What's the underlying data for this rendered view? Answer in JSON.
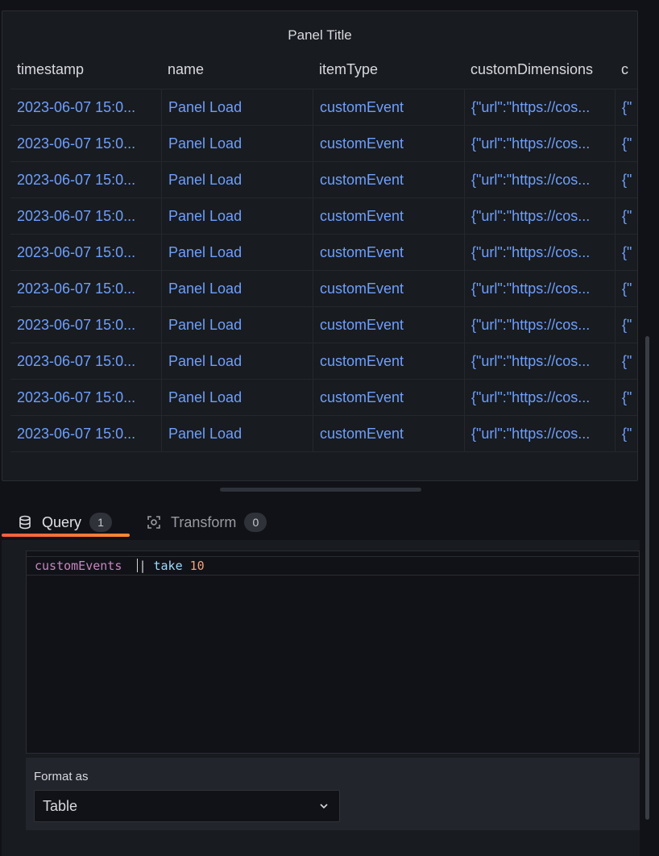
{
  "panel": {
    "title": "Panel Title",
    "columns": [
      "timestamp",
      "name",
      "itemType",
      "customDimensions",
      "c"
    ],
    "rows": [
      [
        "2023-06-07 15:0...",
        "Panel Load",
        "customEvent",
        "{\"url\":\"https://cos...",
        "{\""
      ],
      [
        "2023-06-07 15:0...",
        "Panel Load",
        "customEvent",
        "{\"url\":\"https://cos...",
        "{\""
      ],
      [
        "2023-06-07 15:0...",
        "Panel Load",
        "customEvent",
        "{\"url\":\"https://cos...",
        "{\""
      ],
      [
        "2023-06-07 15:0...",
        "Panel Load",
        "customEvent",
        "{\"url\":\"https://cos...",
        "{\""
      ],
      [
        "2023-06-07 15:0...",
        "Panel Load",
        "customEvent",
        "{\"url\":\"https://cos...",
        "{\""
      ],
      [
        "2023-06-07 15:0...",
        "Panel Load",
        "customEvent",
        "{\"url\":\"https://cos...",
        "{\""
      ],
      [
        "2023-06-07 15:0...",
        "Panel Load",
        "customEvent",
        "{\"url\":\"https://cos...",
        "{\""
      ],
      [
        "2023-06-07 15:0...",
        "Panel Load",
        "customEvent",
        "{\"url\":\"https://cos...",
        "{\""
      ],
      [
        "2023-06-07 15:0...",
        "Panel Load",
        "customEvent",
        "{\"url\":\"https://cos...",
        "{\""
      ],
      [
        "2023-06-07 15:0...",
        "Panel Load",
        "customEvent",
        "{\"url\":\"https://cos...",
        "{\""
      ]
    ]
  },
  "tabs": {
    "query": {
      "label": "Query",
      "count": "1",
      "icon": "database-icon"
    },
    "transform": {
      "label": "Transform",
      "count": "0",
      "icon": "transform-icon"
    }
  },
  "editor": {
    "table": "customEvents",
    "pipe": "|",
    "operator": "take",
    "number": "10"
  },
  "format": {
    "label": "Format as",
    "value": "Table"
  },
  "colors": {
    "accent": "#f55f3e",
    "link": "#6e9fff",
    "background": "#111217",
    "panel": "#181b1f"
  }
}
